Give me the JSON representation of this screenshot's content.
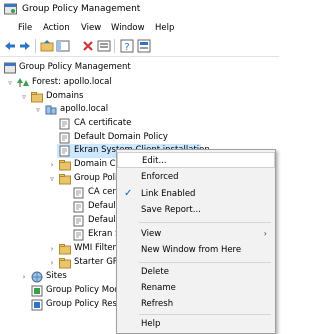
{
  "window": {
    "title": "Group Policy Management"
  },
  "menu": [
    "File",
    "Action",
    "View",
    "Window",
    "Help"
  ],
  "toolbar": {
    "icons": [
      "back-icon",
      "forward-icon",
      "folder-up-icon",
      "show-hide-icon",
      "delete-icon",
      "refresh-icon",
      "help-icon",
      "properties-icon"
    ]
  },
  "tree": {
    "root": "Group Policy Management",
    "forest": "Forest: apollo.local",
    "domains": "Domains",
    "domain": "apollo.local",
    "items": [
      "CA certificate",
      "Default Domain Policy",
      "Ekran System Client installation",
      "Domain Co",
      "Group Poli"
    ],
    "gpos": [
      "CA cer",
      "Default",
      "Default",
      "Ekran S"
    ],
    "wmi": "WMI Filter",
    "starter": "Starter GPO",
    "sites": "Sites",
    "modeling": "Group Policy Mod",
    "results": "Group Policy Resu"
  },
  "context_menu": {
    "edit": "Edit...",
    "enforced": "Enforced",
    "link_enabled": "Link Enabled",
    "save_report": "Save Report...",
    "view": "View",
    "new_window": "New Window from Here",
    "delete": "Delete",
    "rename": "Rename",
    "refresh": "Refresh",
    "help": "Help"
  },
  "colors": {
    "selection": "#cce8ff",
    "menu_bg": "#f2f2f2",
    "check": "#0067c0"
  }
}
